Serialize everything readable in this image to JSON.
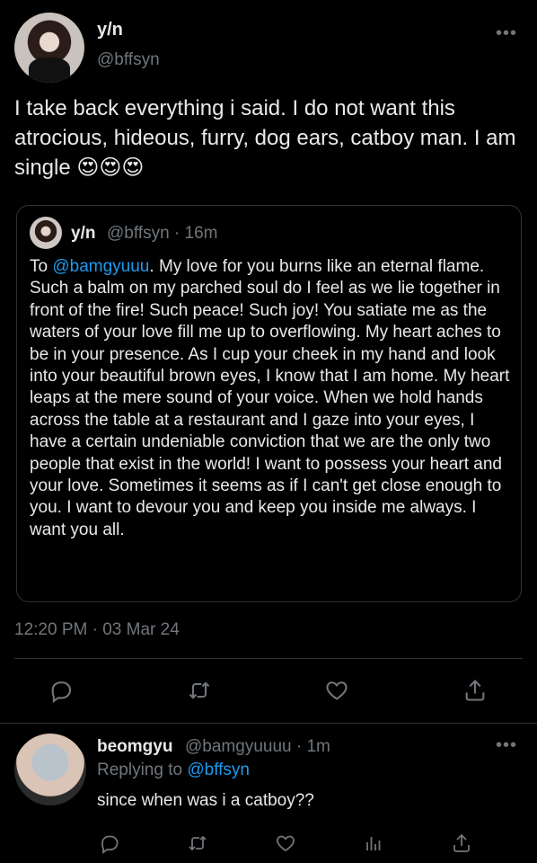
{
  "tweet": {
    "display_name": "y/n",
    "handle": "@bffsyn",
    "text": "I take back everything i said. I do not want this atrocious, hideous, furry, dog ears, catboy man. I am single 😍😍😍",
    "timestamp": "12:20 PM · 03 Mar 24"
  },
  "quote": {
    "display_name": "y/n",
    "meta": "@bffsyn · 16m",
    "prefix": "To ",
    "mention": "@bamgyuuu",
    "body": ". My love for you burns like an eternal flame. Such a balm on my parched soul do I feel as we lie together in front of the fire! Such peace! Such joy! You satiate me as the waters of your love fill me up to overflowing. My heart aches to be in your presence. As I cup your cheek in my hand and look into your beautiful brown eyes, I know that I am home. My heart leaps at the mere sound of your voice. When we hold hands across the table at a restaurant and I gaze into your eyes, I have a certain undeniable conviction that we are the only two people that exist in the world! I want to possess your heart and your love. Sometimes it seems as if I can't get close enough to you. I want to devour you and keep you inside me always. I want you all."
  },
  "reply": {
    "display_name": "beomgyu",
    "meta": "@bamgyuuuu · 1m",
    "replying_prefix": "Replying to ",
    "replying_mention": "@bffsyn",
    "text": "since when was i a catboy??"
  },
  "icons": {
    "more": "•••",
    "actions": [
      "reply-icon",
      "retweet-icon",
      "like-icon",
      "share-icon",
      "views-icon"
    ]
  },
  "colors": {
    "background": "#000000",
    "text": "#e7e9ea",
    "secondary": "#71767b",
    "accent": "#1d9bf0",
    "border": "#2f3336"
  }
}
